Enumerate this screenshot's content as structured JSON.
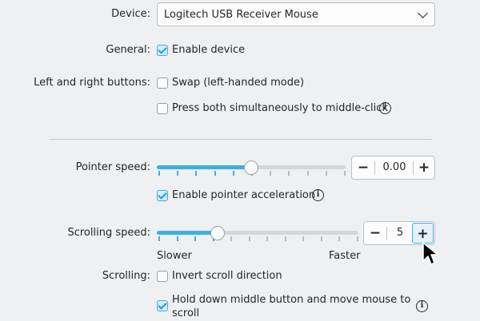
{
  "device": {
    "label": "Device:",
    "selected": "Logitech USB Receiver Mouse"
  },
  "general": {
    "label": "General:",
    "enable_device": {
      "label": "Enable device",
      "checked": true
    }
  },
  "buttons": {
    "label": "Left and right buttons:",
    "swap": {
      "label": "Swap (left-handed mode)",
      "checked": false
    },
    "middle_click": {
      "label": "Press both simultaneously to middle-click",
      "checked": false
    }
  },
  "pointer_speed": {
    "label": "Pointer speed:",
    "value": "0.00",
    "slider_fraction": 0.5,
    "acceleration": {
      "label": "Enable pointer acceleration",
      "checked": true
    }
  },
  "scrolling_speed": {
    "label": "Scrolling speed:",
    "value": "5",
    "slider_fraction": 0.3,
    "slower_label": "Slower",
    "faster_label": "Faster"
  },
  "scrolling": {
    "label": "Scrolling:",
    "invert": {
      "label": "Invert scroll direction",
      "checked": false
    },
    "middle_button_scroll": {
      "label_line1": "Hold down middle button and move mouse to",
      "label_line2": "scroll",
      "checked": true
    }
  },
  "icons": {
    "info": "info-icon",
    "minus": "minus-icon",
    "plus": "plus-icon",
    "dropdown": "chevron-down-icon",
    "cursor": "mouse-cursor-icon"
  },
  "glyphs": {
    "info": "i",
    "minus": "−",
    "plus": "+"
  },
  "colors": {
    "accent": "#3daee9",
    "background": "#eff0f1",
    "text": "#232629"
  }
}
